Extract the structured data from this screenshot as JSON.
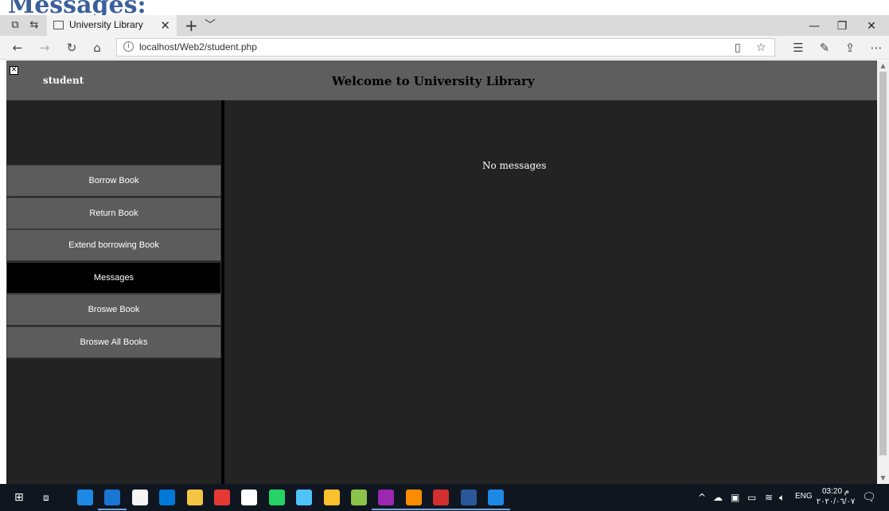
{
  "page": {
    "heading": "Messages:"
  },
  "browser": {
    "tab_title": "University Library",
    "url": "localhost/Web2/student.php"
  },
  "app": {
    "user_label": "student",
    "header_title": "Welcome to University Library",
    "menu": [
      {
        "label": "Borrow Book",
        "active": false
      },
      {
        "label": "Return Book",
        "active": false
      },
      {
        "label": "Extend borrowing Book",
        "active": false
      },
      {
        "label": "Messages",
        "active": true
      },
      {
        "label": "Broswe Book",
        "active": false
      },
      {
        "label": "Broswe All Books",
        "active": false
      }
    ],
    "content_text": "No messages"
  },
  "taskbar": {
    "language": "ENG",
    "time": "03:20 م",
    "date": "٢٠٢٠/٠٦/٠٧",
    "apps": [
      {
        "icon": "people-icon",
        "color": "#1e88e5"
      },
      {
        "icon": "edge-icon",
        "color": "#1976d2"
      },
      {
        "icon": "store-icon",
        "color": "#f5f5f5"
      },
      {
        "icon": "mail-icon",
        "color": "#0078d7"
      },
      {
        "icon": "file-explorer-icon",
        "color": "#f4c542"
      },
      {
        "icon": "chrome-icon",
        "color": "#e53935"
      },
      {
        "icon": "settings-icon",
        "color": "#ffffff"
      },
      {
        "icon": "whatsapp-icon",
        "color": "#25d366"
      },
      {
        "icon": "virtualbox-icon",
        "color": "#4fc3f7"
      },
      {
        "icon": "tiles-icon",
        "color": "#fbc02d"
      },
      {
        "icon": "media-icon",
        "color": "#8bc34a"
      },
      {
        "icon": "visual-studio-icon",
        "color": "#9c27b0"
      },
      {
        "icon": "xampp-icon",
        "color": "#fb8c00"
      },
      {
        "icon": "acrobat-icon",
        "color": "#d32f2f"
      },
      {
        "icon": "word-icon",
        "color": "#2b579a"
      },
      {
        "icon": "vscode-icon",
        "color": "#1e88e5"
      }
    ]
  }
}
